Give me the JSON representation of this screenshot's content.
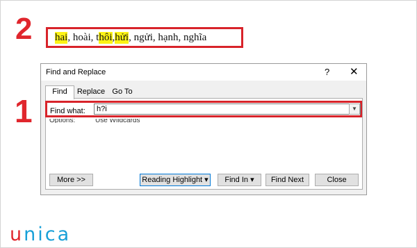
{
  "steps": {
    "two": "2",
    "one": "1"
  },
  "words": [
    {
      "text": "hai",
      "highlighted": true
    },
    {
      "text": ", hoài, t",
      "highlighted": false
    },
    {
      "text": "hôi",
      "highlighted": true
    },
    {
      "text": ", ",
      "highlighted": false
    },
    {
      "text": "hửi",
      "highlighted": true
    },
    {
      "text": ", ngửi, hạnh, nghĩa",
      "highlighted": false
    }
  ],
  "dialog": {
    "title": "Find and Replace",
    "help_glyph": "?",
    "close_glyph": "✕",
    "tabs": {
      "find": "Find",
      "replace": "Replace",
      "goto": "Go To"
    },
    "find_label": "Find what:",
    "find_value": "h?i",
    "options_label": "Options:",
    "options_value": "Use Wildcards",
    "buttons": {
      "more": "More >>",
      "reading_highlight": "Reading Highlight ▾",
      "find_in": "Find In ▾",
      "find_next": "Find Next",
      "close": "Close"
    }
  },
  "logo": {
    "first": "u",
    "rest": "nica"
  },
  "colors": {
    "accent_red": "#d8232a",
    "highlight_yellow": "#fdf315",
    "logo_blue": "#18a0d8"
  }
}
